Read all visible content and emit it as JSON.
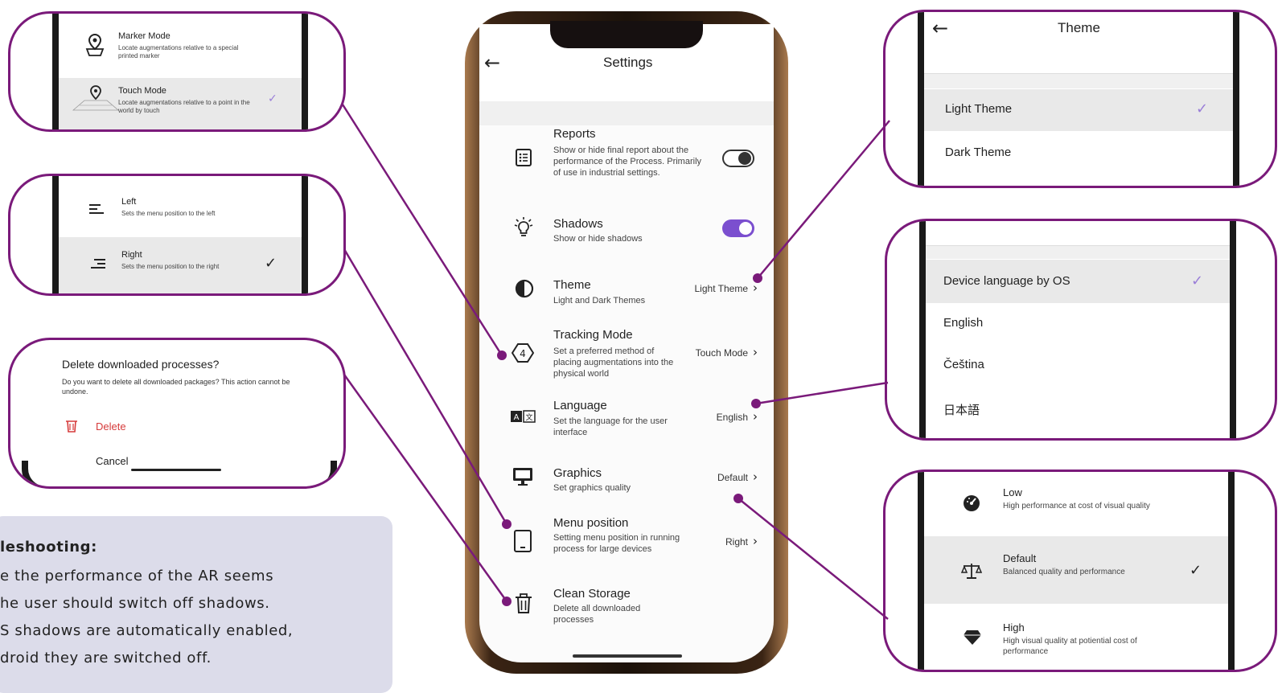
{
  "settings": {
    "title": "Settings",
    "rows": [
      {
        "title": "Reports",
        "desc": "Show or hide final report about the performance of the Process. Primarily of use in industrial settings.",
        "icon": "report-list-icon"
      },
      {
        "title": "Shadows",
        "desc": "Show or hide shadows",
        "icon": "lightbulb-icon"
      },
      {
        "title": "Theme",
        "desc": "Light and Dark Themes",
        "value": "Light Theme",
        "icon": "contrast-icon"
      },
      {
        "title": "Tracking Mode",
        "desc": "Set a preferred method of placing augmentations into the physical world",
        "value": "Touch Mode",
        "icon": "tracking-icon"
      },
      {
        "title": "Language",
        "desc": "Set the language for the user interface",
        "value": "English",
        "icon": "translate-icon"
      },
      {
        "title": "Graphics",
        "desc": "Set graphics quality",
        "value": "Default",
        "icon": "monitor-icon"
      },
      {
        "title": "Menu position",
        "desc": "Setting menu position in running process for large devices",
        "value": "Right",
        "icon": "tablet-icon"
      },
      {
        "title": "Clean Storage",
        "desc": "Delete all downloaded processes",
        "icon": "trash-icon"
      }
    ],
    "reports_enabled": false,
    "shadows_enabled": true
  },
  "tracking_callout": {
    "options": [
      {
        "title": "Marker Mode",
        "desc": "Locate augmentations relative to a special printed marker"
      },
      {
        "title": "Touch Mode",
        "desc": "Locate augmentations relative to a point in the world by touch"
      }
    ]
  },
  "menu_callout": {
    "options": [
      {
        "title": "Left",
        "desc": "Sets the menu position to the left"
      },
      {
        "title": "Right",
        "desc": "Sets the menu position to the right"
      }
    ]
  },
  "delete_callout": {
    "title": "Delete downloaded processes?",
    "body": "Do you want to delete all downloaded packages? This action cannot be undone.",
    "delete_label": "Delete",
    "cancel_label": "Cancel"
  },
  "theme_callout": {
    "title": "Theme",
    "options": [
      "Light Theme",
      "Dark Theme"
    ]
  },
  "language_callout": {
    "options": [
      "Device language by OS",
      "English",
      "Čeština",
      "日本語"
    ]
  },
  "graphics_callout": {
    "options": [
      {
        "title": "Low",
        "desc": "High performance at cost of visual quality"
      },
      {
        "title": "Default",
        "desc": "Balanced quality and performance"
      },
      {
        "title": "High",
        "desc": "High visual quality at potiential cost of performance"
      }
    ]
  },
  "troubleshooting": {
    "heading": "leshooting",
    "lines": [
      "e the performance of the AR seems",
      "he user should switch off shadows.",
      "S shadows are automatically enabled,",
      "droid they are switched off."
    ]
  },
  "colors": {
    "accent": "#7b4fcf",
    "callout_border": "#7a1a7a",
    "delete_red": "#d63b3b"
  }
}
